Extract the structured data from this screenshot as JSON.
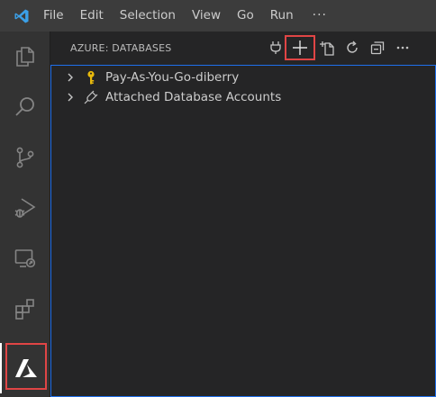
{
  "menu": {
    "items": [
      "File",
      "Edit",
      "Selection",
      "View",
      "Go",
      "Run"
    ],
    "more": "···"
  },
  "activity_bar": {
    "items": [
      "explorer-icon",
      "search-icon",
      "source-control-icon",
      "run-debug-icon",
      "remote-explorer-icon",
      "extensions-icon",
      "azure-icon"
    ],
    "active": "azure-icon"
  },
  "sidebar": {
    "title": "AZURE: DATABASES",
    "toolbar": [
      "plug-icon",
      "plus-icon",
      "new-file-icon",
      "refresh-icon",
      "collapse-all-icon",
      "more-icon"
    ],
    "tree": [
      {
        "label": "Pay-As-You-Go-diberry",
        "icon": "key-icon"
      },
      {
        "label": "Attached Database Accounts",
        "icon": "plug-icon"
      }
    ]
  },
  "colors": {
    "highlight": "#e04545",
    "focus_border": "#1f6feb",
    "key_icon": "#e8b90c",
    "vscode_blue": "#3ba0e8"
  }
}
